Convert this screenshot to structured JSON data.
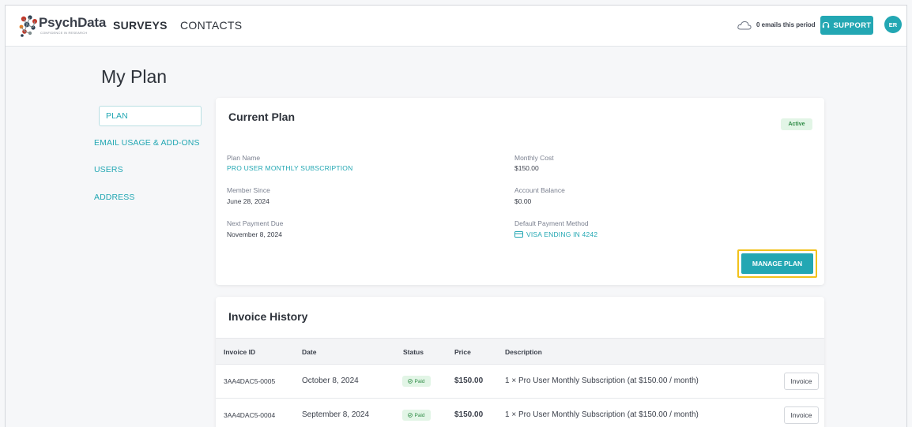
{
  "nav": {
    "brand": "PsychData",
    "brand_tagline": "CONFIDENCE IN RESEARCH",
    "surveys": "SURVEYS",
    "contacts": "CONTACTS",
    "emails_period": "0 emails this period",
    "support": "SUPPORT",
    "avatar_initials": "ER",
    "icons": {
      "cloud": "cloud-icon",
      "support": "headset-icon"
    }
  },
  "page": {
    "title": "My Plan"
  },
  "sidebar": {
    "items": [
      {
        "label": "PLAN",
        "active": true
      },
      {
        "label": "EMAIL USAGE & ADD-ONS",
        "active": false
      },
      {
        "label": "USERS",
        "active": false
      },
      {
        "label": "ADDRESS",
        "active": false
      }
    ]
  },
  "current_plan": {
    "title": "Current Plan",
    "status": "Active",
    "plan_name_label": "Plan Name",
    "plan_name": "PRO USER MONTHLY SUBSCRIPTION",
    "member_since_label": "Member Since",
    "member_since": "June 28, 2024",
    "next_payment_label": "Next Payment Due",
    "next_payment": "November 8, 2024",
    "monthly_cost_label": "Monthly Cost",
    "monthly_cost": "$150.00",
    "account_balance_label": "Account Balance",
    "account_balance": "$0.00",
    "payment_method_label": "Default Payment Method",
    "payment_method": "VISA ENDING IN 4242",
    "manage_button": "MANAGE PLAN"
  },
  "invoice_history": {
    "title": "Invoice History",
    "columns": [
      "Invoice ID",
      "Date",
      "Status",
      "Price",
      "Description"
    ],
    "rows": [
      {
        "id": "3AA4DAC5-0005",
        "date": "October 8, 2024",
        "status": "Paid",
        "price": "$150.00",
        "description": "1 × Pro User Monthly Subscription (at $150.00 / month)",
        "action": "Invoice"
      },
      {
        "id": "3AA4DAC5-0004",
        "date": "September 8, 2024",
        "status": "Paid",
        "price": "$150.00",
        "description": "1 × Pro User Monthly Subscription (at $150.00 / month)",
        "action": "Invoice"
      }
    ]
  },
  "colors": {
    "accent": "#23a7b3",
    "highlight": "#f2c21b",
    "success_bg": "#e2f5e6",
    "success_text": "#2e8b45"
  }
}
